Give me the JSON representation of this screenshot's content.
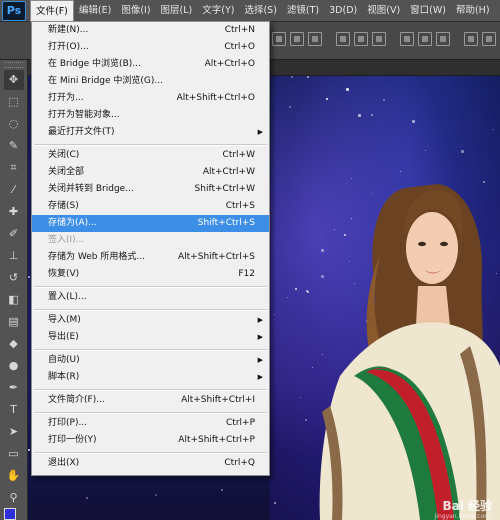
{
  "app": {
    "logo": "Ps"
  },
  "menubar": [
    {
      "label": "文件(F)",
      "active": true
    },
    {
      "label": "编辑(E)"
    },
    {
      "label": "图像(I)"
    },
    {
      "label": "图层(L)"
    },
    {
      "label": "文字(Y)"
    },
    {
      "label": "选择(S)"
    },
    {
      "label": "滤镜(T)"
    },
    {
      "label": "3D(D)"
    },
    {
      "label": "视图(V)"
    },
    {
      "label": "窗口(W)"
    },
    {
      "label": "帮助(H)"
    }
  ],
  "file_menu": {
    "items": [
      {
        "label": "新建(N)...",
        "shortcut": "Ctrl+N"
      },
      {
        "label": "打开(O)...",
        "shortcut": "Ctrl+O"
      },
      {
        "label": "在 Bridge 中浏览(B)...",
        "shortcut": "Alt+Ctrl+O"
      },
      {
        "label": "在 Mini Bridge 中浏览(G)...",
        "shortcut": ""
      },
      {
        "label": "打开为...",
        "shortcut": "Alt+Shift+Ctrl+O"
      },
      {
        "label": "打开为智能对象...",
        "shortcut": ""
      },
      {
        "label": "最近打开文件(T)",
        "shortcut": "",
        "submenu": true
      },
      {
        "separator": true
      },
      {
        "label": "关闭(C)",
        "shortcut": "Ctrl+W"
      },
      {
        "label": "关闭全部",
        "shortcut": "Alt+Ctrl+W"
      },
      {
        "label": "关闭并转到 Bridge...",
        "shortcut": "Shift+Ctrl+W"
      },
      {
        "label": "存储(S)",
        "shortcut": "Ctrl+S"
      },
      {
        "label": "存储为(A)...",
        "shortcut": "Shift+Ctrl+S",
        "highlighted": true
      },
      {
        "label": "签入(I)...",
        "shortcut": "",
        "disabled": true
      },
      {
        "label": "存储为 Web 所用格式...",
        "shortcut": "Alt+Shift+Ctrl+S"
      },
      {
        "label": "恢复(V)",
        "shortcut": "F12"
      },
      {
        "separator": true
      },
      {
        "label": "置入(L)...",
        "shortcut": ""
      },
      {
        "separator": true
      },
      {
        "label": "导入(M)",
        "shortcut": "",
        "submenu": true
      },
      {
        "label": "导出(E)",
        "shortcut": "",
        "submenu": true
      },
      {
        "separator": true
      },
      {
        "label": "自动(U)",
        "shortcut": "",
        "submenu": true
      },
      {
        "label": "脚本(R)",
        "shortcut": "",
        "submenu": true
      },
      {
        "separator": true
      },
      {
        "label": "文件简介(F)...",
        "shortcut": "Alt+Shift+Ctrl+I"
      },
      {
        "separator": true
      },
      {
        "label": "打印(P)...",
        "shortcut": "Ctrl+P"
      },
      {
        "label": "打印一份(Y)",
        "shortcut": "Alt+Shift+Ctrl+P"
      },
      {
        "separator": true
      },
      {
        "label": "退出(X)",
        "shortcut": "Ctrl+Q"
      }
    ],
    "submenu_arrow": "▶"
  },
  "tools": [
    {
      "icon": "move-icon",
      "glyph": "✥",
      "selected": true
    },
    {
      "icon": "marquee-icon",
      "glyph": "⬚"
    },
    {
      "icon": "lasso-icon",
      "glyph": "◌"
    },
    {
      "icon": "quick-select-icon",
      "glyph": "✎"
    },
    {
      "icon": "crop-icon",
      "glyph": "⌗"
    },
    {
      "icon": "eyedropper-icon",
      "glyph": "⁄"
    },
    {
      "icon": "healing-brush-icon",
      "glyph": "✚"
    },
    {
      "icon": "brush-icon",
      "glyph": "✐"
    },
    {
      "icon": "clone-stamp-icon",
      "glyph": "⊥"
    },
    {
      "icon": "history-brush-icon",
      "glyph": "↺"
    },
    {
      "icon": "eraser-icon",
      "glyph": "◧"
    },
    {
      "icon": "gradient-icon",
      "glyph": "▤"
    },
    {
      "icon": "blur-icon",
      "glyph": "◆"
    },
    {
      "icon": "dodge-icon",
      "glyph": "●"
    },
    {
      "icon": "pen-icon",
      "glyph": "✒"
    },
    {
      "icon": "type-icon",
      "glyph": "T"
    },
    {
      "icon": "path-select-icon",
      "glyph": "➤"
    },
    {
      "icon": "shape-icon",
      "glyph": "▭"
    },
    {
      "icon": "hand-icon",
      "glyph": "✋"
    },
    {
      "icon": "zoom-icon",
      "glyph": "⚲"
    }
  ],
  "colors": {
    "menu_highlight": "#3d8ee6",
    "foreground_swatch": "#2d2fd8"
  },
  "watermark": {
    "text": "Bai 经验",
    "sub": "jingyan.baidu.com"
  }
}
